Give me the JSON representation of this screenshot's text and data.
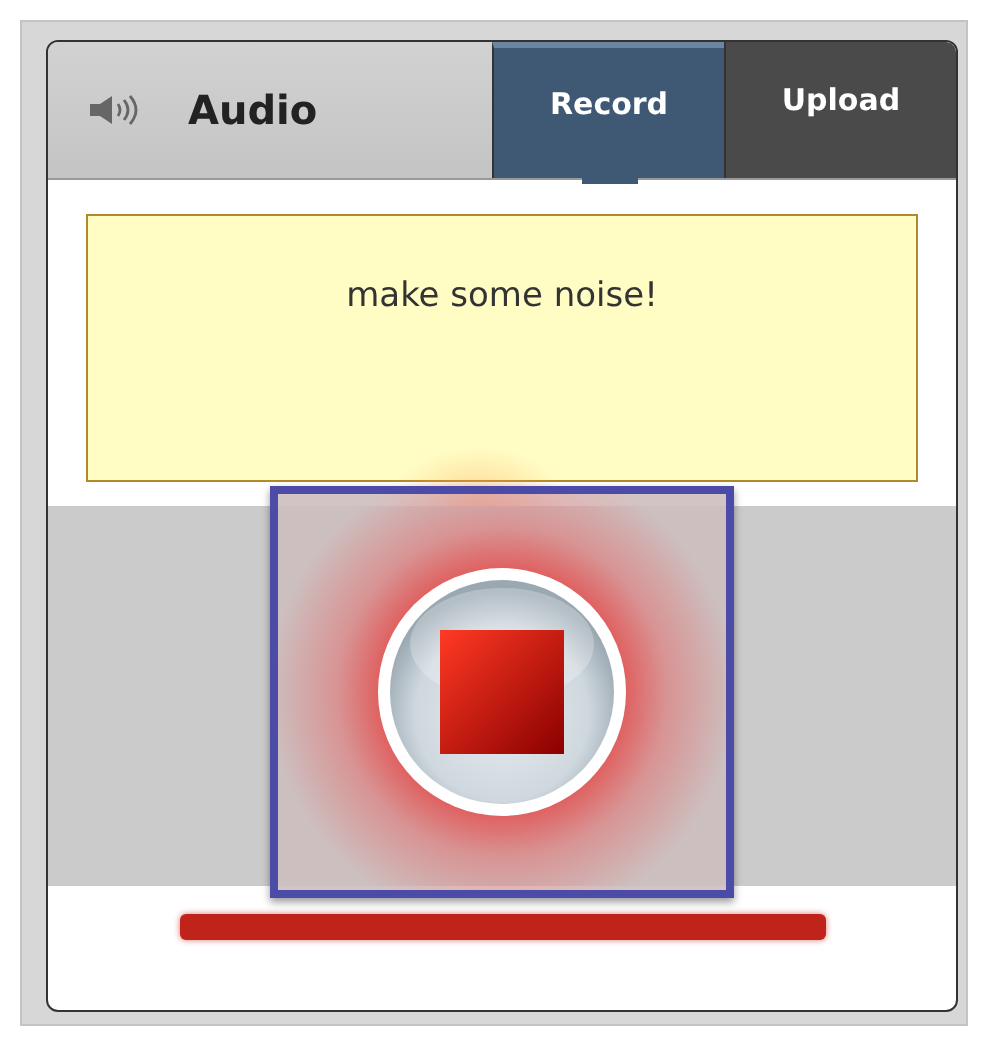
{
  "header": {
    "title": "Audio"
  },
  "tabs": [
    {
      "label": "Record",
      "selected": true
    },
    {
      "label": "Upload",
      "selected": false
    }
  ],
  "message": "make some noise!",
  "recorder": {
    "recording": true
  }
}
